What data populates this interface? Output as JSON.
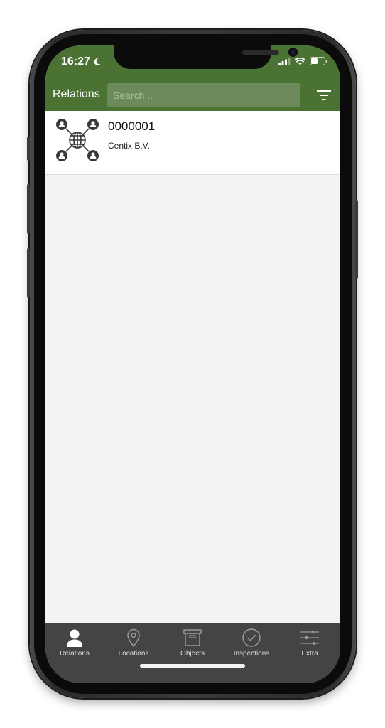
{
  "status_bar": {
    "time": "16:27"
  },
  "navbar": {
    "title": "Relations",
    "search_placeholder": "Search..."
  },
  "relations": [
    {
      "code": "0000001",
      "name": "Centix B.V."
    }
  ],
  "tabs": [
    {
      "label": "Relations",
      "icon": "person-icon",
      "active": true
    },
    {
      "label": "Locations",
      "icon": "location-pin-icon",
      "active": false
    },
    {
      "label": "Objects",
      "icon": "archive-box-icon",
      "active": false
    },
    {
      "label": "Inspections",
      "icon": "check-circle-icon",
      "active": false
    },
    {
      "label": "Extra",
      "icon": "sliders-icon",
      "active": false
    }
  ],
  "colors": {
    "header": "#4a7233",
    "tabbar": "#444444",
    "background": "#f3f3f3"
  }
}
